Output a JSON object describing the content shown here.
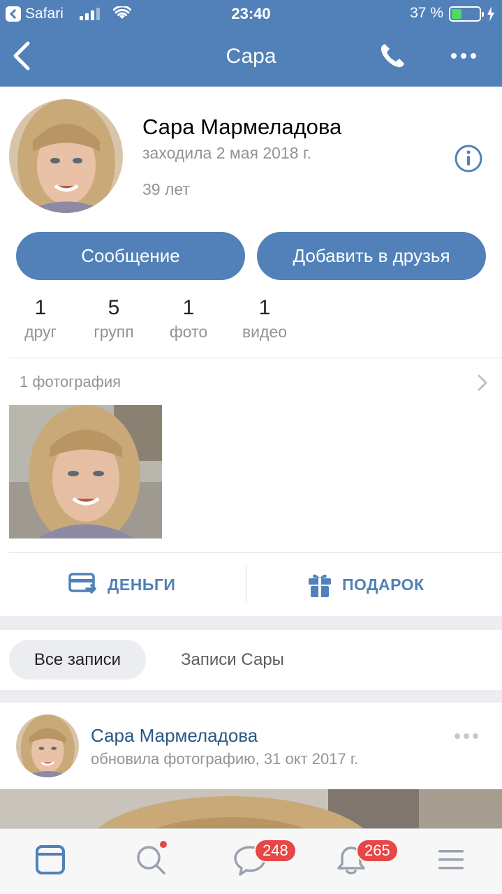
{
  "status": {
    "app_back": "Safari",
    "time": "23:40",
    "battery": "37 %",
    "battery_level": 0.37
  },
  "nav": {
    "title": "Сара"
  },
  "profile": {
    "name": "Сара Мармеладова",
    "last_seen": "заходила 2 мая 2018 г.",
    "age": "39 лет",
    "message_button": "Сообщение",
    "add_friend_button": "Добавить в друзья",
    "counters": [
      {
        "num": "1",
        "label": "друг"
      },
      {
        "num": "5",
        "label": "групп"
      },
      {
        "num": "1",
        "label": "фото"
      },
      {
        "num": "1",
        "label": "видео"
      }
    ],
    "photos_header": "1 фотография",
    "money_label": "ДЕНЬГИ",
    "gift_label": "ПОДАРОК"
  },
  "tabs": {
    "all_posts": "Все записи",
    "own_posts": "Записи Сары"
  },
  "post": {
    "author": "Сара Мармеладова",
    "meta": "обновила фотографию, 31 окт 2017 г."
  },
  "tabbar": {
    "messages_badge": "248",
    "notifications_badge": "265"
  },
  "colors": {
    "accent": "#5181b8",
    "link": "#2a5885",
    "badge": "#e64646",
    "secondary_text": "#909499"
  }
}
